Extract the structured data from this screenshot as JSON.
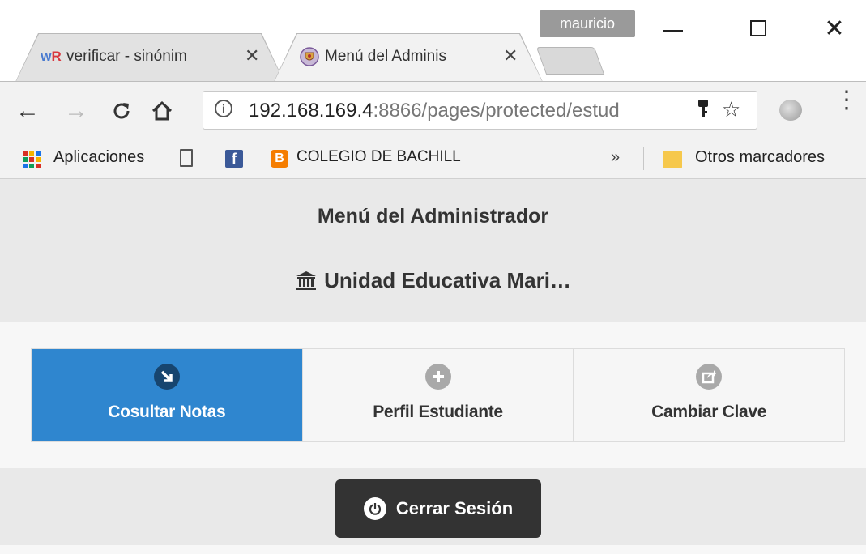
{
  "window": {
    "profile_name": "mauricio",
    "minimize_label": "",
    "close_glyph": "✕"
  },
  "tabs": [
    {
      "favicon": "wR",
      "label": "verificar - sinónim",
      "close": "✕"
    },
    {
      "favicon": "shield-crest",
      "label": "Menú del Adminis",
      "close": "✕"
    }
  ],
  "toolbar": {
    "back": "←",
    "forward": "→",
    "reload": "C",
    "home": "⌂",
    "url_host": "192.168.169.4",
    "url_rest": ":8866/pages/protected/estud",
    "star": "☆",
    "menu": "⋮"
  },
  "bookmarks": {
    "apps_label": "Aplicaciones",
    "colegio_label": "COLEGIO DE BACHILL",
    "overflow": "»",
    "others_label": "Otros marcadores"
  },
  "page": {
    "title": "Menú del Administrador",
    "school_name": "Unidad Educativa Mari…",
    "menu_items": [
      {
        "label": "Cosultar Notas",
        "icon": "arrow-down-right-circle-icon",
        "active": true
      },
      {
        "label": "Perfil Estudiante",
        "icon": "plus-circle-icon",
        "active": false
      },
      {
        "label": "Cambiar Clave",
        "icon": "share-circle-icon",
        "active": false
      }
    ],
    "logout_label": "Cerrar Sesión"
  },
  "colors": {
    "active_blue": "#2f86cf",
    "logout_bg": "#333333"
  }
}
